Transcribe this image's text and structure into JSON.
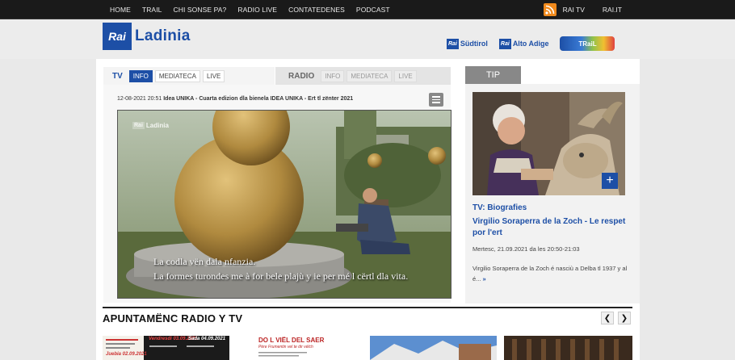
{
  "topnav": [
    "HOME",
    "TRAIL",
    "CHI SONSE PA?",
    "RADIO LIVE",
    "CONTATEDENES",
    "PODCAST"
  ],
  "topright": {
    "rai_tv": "RAI TV",
    "rai_it": "RAI.IT"
  },
  "logo": {
    "box": "Rai",
    "text": "Ladinia"
  },
  "partners": [
    {
      "box": "Rai",
      "text": "Südtirol"
    },
    {
      "box": "Rai",
      "text": "Alto Adige"
    }
  ],
  "trail_label": "TRaiL",
  "tv": {
    "head": "TV",
    "tabs": [
      "INFO",
      "MEDIATECA",
      "LIVE"
    ]
  },
  "radio": {
    "head": "RADIO",
    "tabs": [
      "INFO",
      "MEDIATECA",
      "LIVE"
    ]
  },
  "video": {
    "date": "12-08-2021 20:51",
    "title": "Idea UNIKA - Cuarta edizion dla bienela IDEA UNIKA - Ert tl zënter 2021",
    "watermark_box": "Rai",
    "watermark_text": "Ladinia",
    "subtitle1": "La codla vën dala nfanzia.",
    "subtitle2": "La formes turondes me à for bele plajù y ie per mé l cërtl dla vita."
  },
  "tip": {
    "head": "TIP",
    "category": "TV: Biografies",
    "title": "Virgilio Soraperra de la Zoch - Le respet por l'ert",
    "date": "Mertesc, 21.09.2021 da les 20:50-21:03",
    "desc": "Virgilio Soraperra de la Zoch é nasciù a Delba tl 1937 y al é...",
    "more": "»"
  },
  "apuntamenc": {
    "title": "APUNTAMËNC RADIO Y TV"
  },
  "thumbs": [
    {
      "t1": "Vendresdì 03.09.2021",
      "t2": "Sada 04.09.2021",
      "t3": "Juebia 02.09.2021"
    },
    {
      "t1": "DO L VIËL DEL SAER",
      "t2": "Père Frumentin vel te dir vélch"
    }
  ],
  "colors": {
    "brand_blue": "#1d4fa6",
    "rss_orange": "#f18a1c"
  }
}
